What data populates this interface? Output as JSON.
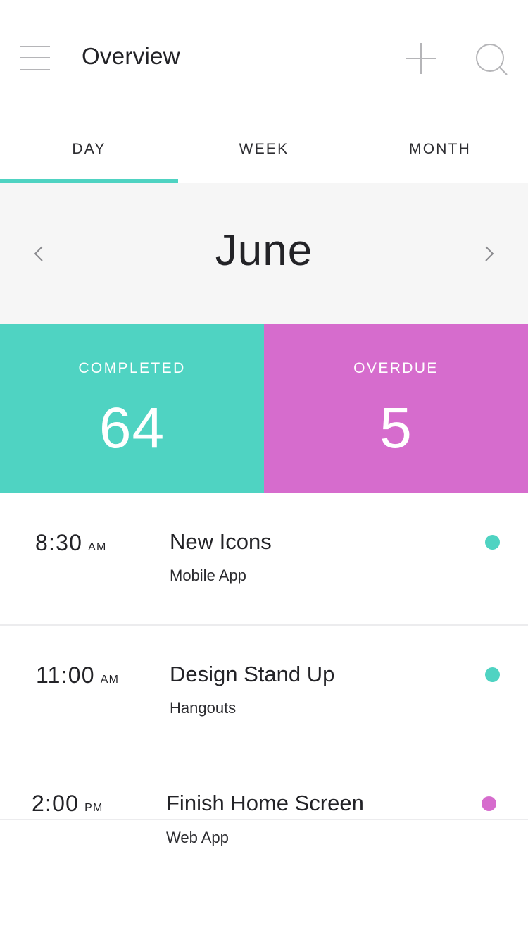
{
  "header": {
    "title": "Overview"
  },
  "tabs": [
    {
      "label": "DAY"
    },
    {
      "label": "WEEK"
    },
    {
      "label": "MONTH"
    }
  ],
  "month": {
    "label": "June"
  },
  "stats": {
    "completed": {
      "label": "COMPLETED",
      "value": "64",
      "color": "#4fd3c2"
    },
    "overdue": {
      "label": "OVERDUE",
      "value": "5",
      "color": "#d66ccd"
    }
  },
  "events": [
    {
      "time": "8:30",
      "period": "AM",
      "title": "New Icons",
      "subtitle": "Mobile App",
      "status_color": "#4fd3c2"
    },
    {
      "time": "11:00",
      "period": "AM",
      "title": "Design Stand Up",
      "subtitle": "Hangouts",
      "status_color": "#4fd3c2"
    },
    {
      "time": "2:00",
      "period": "PM",
      "title": "Finish Home Screen",
      "subtitle": "Web App",
      "status_color": "#d66ccd"
    }
  ],
  "icons": {
    "menu": "menu-icon",
    "add": "plus-icon",
    "search": "search-icon",
    "prev": "chevron-left-icon",
    "next": "chevron-right-icon"
  },
  "colors": {
    "accent": "#4fd3c2",
    "overdue": "#d66ccd",
    "month_bar_bg": "#f6f6f6"
  }
}
